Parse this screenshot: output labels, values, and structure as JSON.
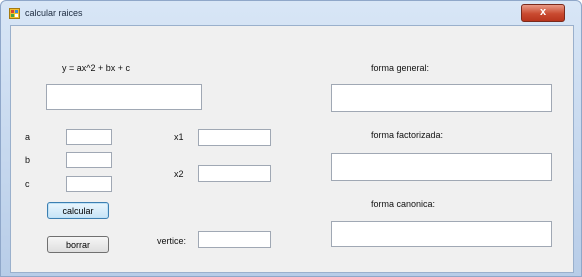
{
  "window": {
    "title": "calcular raices",
    "close_glyph": "x",
    "app_icon": "app-window-icon"
  },
  "form": {
    "equation_label": "y = ax^2 + bx + c",
    "equation_value": "",
    "a_label": "a",
    "a_value": "",
    "b_label": "b",
    "b_value": "",
    "c_label": "c",
    "c_value": "",
    "x1_label": "x1",
    "x1_value": "",
    "x2_label": "x2",
    "x2_value": "",
    "vertice_label": "vertice:",
    "vertice_value": "",
    "general_label": "forma general:",
    "general_value": "",
    "factorizada_label": "forma factorizada:",
    "factorizada_value": "",
    "canonica_label": "forma canonica:",
    "canonica_value": "",
    "calcular_label": "calcular",
    "borrar_label": "borrar"
  }
}
